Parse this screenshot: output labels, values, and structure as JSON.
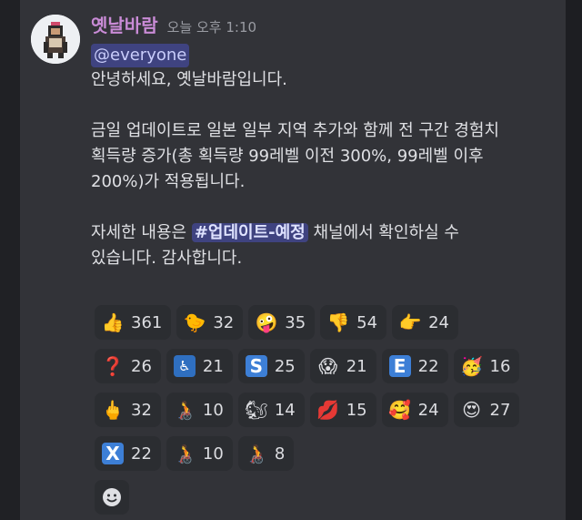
{
  "message": {
    "username": "옛날바람",
    "timestamp": "오늘 오후 1:10",
    "mention": "@everyone",
    "lines": [
      "안녕하세요, 옛날바람입니다.",
      "",
      "금일 업데이트로 일본 일부 지역 추가와 함께 전 구간 경험치",
      "획득량 증가(총 획득량 99레벨 이전 300%, 99레벨 이후",
      "200%)가 적용됩니다.",
      ""
    ],
    "detail_prefix": "자세한 내용은 ",
    "channel": "#업데이트-예정",
    "detail_suffix": " 채널에서 확인하실 수",
    "last_line": "있습니다. 감사합니다."
  },
  "reactions": [
    {
      "icon": "thumbs-up-icon",
      "glyph": "👍",
      "count": "361"
    },
    {
      "icon": "chick-icon",
      "glyph": "🐤",
      "count": "32"
    },
    {
      "icon": "zany-face-icon",
      "glyph": "🤪",
      "count": "35"
    },
    {
      "icon": "thumbs-down-icon",
      "glyph": "👎",
      "count": "54"
    },
    {
      "icon": "point-left-icon",
      "glyph": "👉",
      "count": "24"
    },
    {
      "icon": "red-question-icon",
      "glyph": "❓",
      "count": "26"
    },
    {
      "icon": "wheelchair-symbol-icon",
      "glyph": "♿",
      "count": "21"
    },
    {
      "icon": "letter-s-icon",
      "glyph": "S",
      "count": "25"
    },
    {
      "icon": "screaming-face-icon",
      "glyph": "😱",
      "count": "21"
    },
    {
      "icon": "letter-e-icon",
      "glyph": "E",
      "count": "22"
    },
    {
      "icon": "partying-face-icon",
      "glyph": "🥳",
      "count": "16"
    },
    {
      "icon": "middle-finger-icon",
      "glyph": "🖕",
      "count": "32"
    },
    {
      "icon": "person-wheelchair-icon",
      "glyph": "🧑‍🦽",
      "count": "10"
    },
    {
      "icon": "chipmunk-icon",
      "glyph": "🐿",
      "count": "14"
    },
    {
      "icon": "lips-icon",
      "glyph": "💋",
      "count": "15"
    },
    {
      "icon": "smiling-hearts-icon",
      "glyph": "🥰",
      "count": "24"
    },
    {
      "icon": "heart-eyes-icon",
      "glyph": "😍",
      "count": "27"
    },
    {
      "icon": "letter-x-icon",
      "glyph": "X",
      "count": "22"
    },
    {
      "icon": "person-wheelchair-icon",
      "glyph": "🧑‍🦽",
      "count": "10"
    },
    {
      "icon": "person-wheelchair-icon",
      "glyph": "🧑‍🦽",
      "count": "8"
    }
  ],
  "colors": {
    "username": "#c98bd6",
    "mention_bg": "#3f4380",
    "letter_s": "#3d7fd6",
    "letter_e": "#3d7fd6",
    "letter_x": "#3d7fd6"
  }
}
